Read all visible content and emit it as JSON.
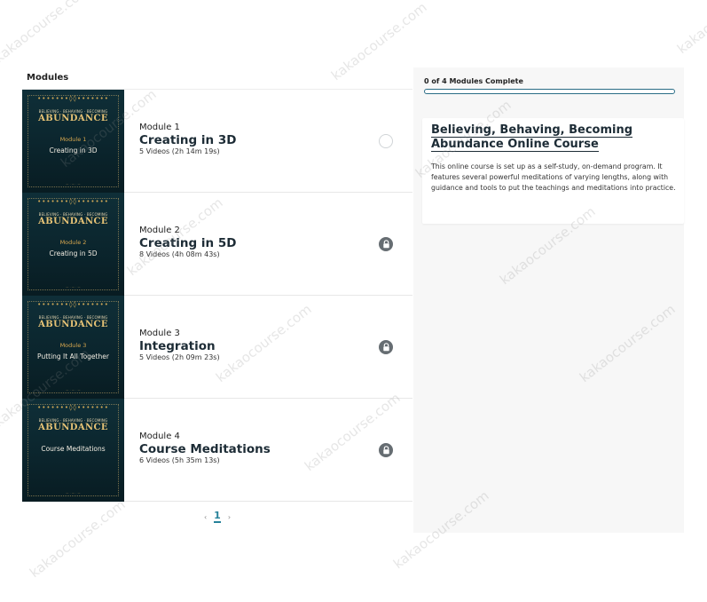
{
  "modules_header": "Modules",
  "modules": [
    {
      "thumb_tagline": "BELIEVING · BEHAVING · BECOMING",
      "thumb_brand": "ABUNDANCE",
      "thumb_module": "Module 1",
      "thumb_name": "Creating in 3D",
      "label": "Module 1",
      "title": "Creating in 3D",
      "videos": "5 Videos (2h 14m 19s)",
      "status": "incomplete"
    },
    {
      "thumb_tagline": "BELIEVING · BEHAVING · BECOMING",
      "thumb_brand": "ABUNDANCE",
      "thumb_module": "Module 2",
      "thumb_name": "Creating in 5D",
      "label": "Module 2",
      "title": "Creating in 5D",
      "videos": "8 Videos (4h 08m 43s)",
      "status": "locked"
    },
    {
      "thumb_tagline": "BELIEVING · BEHAVING · BECOMING",
      "thumb_brand": "ABUNDANCE",
      "thumb_module": "Module 3",
      "thumb_name": "Putting It All Together",
      "label": "Module 3",
      "title": "Integration",
      "videos": "5 Videos (2h 09m 23s)",
      "status": "locked"
    },
    {
      "thumb_tagline": "BELIEVING · BEHAVING · BECOMING",
      "thumb_brand": "ABUNDANCE",
      "thumb_module": "",
      "thumb_name": "Course Meditations",
      "label": "Module 4",
      "title": "Course Meditations",
      "videos": "6 Videos (5h 35m 13s)",
      "status": "locked"
    }
  ],
  "pagination": {
    "prev": "‹",
    "current": "1",
    "next": "›"
  },
  "progress": {
    "text": "0 of 4 Modules Complete",
    "fraction": 0.0
  },
  "course": {
    "title": "Believing, Behaving, Becoming Abundance Online Course",
    "description": "This online course is set up as a self-study, on-demand program. It features several powerful meditations of varying lengths, along with guidance and tools to put the teachings and meditations into practice."
  },
  "watermark": "kakaocourse.com",
  "colors": {
    "accent": "#2a6d86",
    "thumb_bg": "#0f2f38",
    "thumb_gold": "#e4c175",
    "lock": "#666d72"
  },
  "icons": {
    "incomplete": "circle-outline-icon",
    "locked": "lock-icon"
  }
}
